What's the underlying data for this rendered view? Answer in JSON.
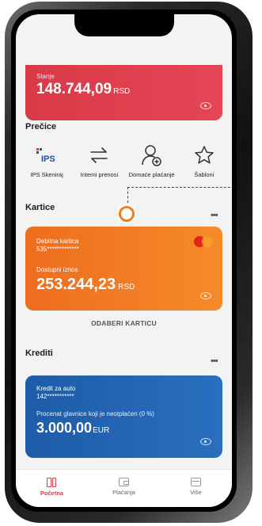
{
  "balance": {
    "label": "Stanje",
    "amount": "148.744,09",
    "currency": "RSD"
  },
  "shortcuts": {
    "title": "Prečice",
    "items": [
      {
        "label": "IPS Skeniraj",
        "icon": "ips-logo-icon"
      },
      {
        "label": "Interni prenosi",
        "icon": "swap-arrows-icon"
      },
      {
        "label": "Domaće plaćanje",
        "icon": "user-add-icon"
      },
      {
        "label": "Šabloni",
        "icon": "star-icon"
      }
    ]
  },
  "cards": {
    "title": "Kartice",
    "more": "•••",
    "card": {
      "type": "Debitna kartica",
      "number": "535*************",
      "available_label": "Dostupni iznos",
      "amount": "253.244,23",
      "currency": "RSD"
    },
    "choose_label": "ODABERI KARTICU"
  },
  "credits": {
    "title": "Krediti",
    "more": "•••",
    "item": {
      "name": "Kredit za auto",
      "number": "142***********",
      "desc": "Procenat glavnice koji je neotplaćen (0 %)",
      "amount": "3.000,00",
      "currency": "EUR"
    }
  },
  "nav": {
    "items": [
      {
        "label": "Početna",
        "icon": "home-icon",
        "active": true
      },
      {
        "label": "Plaćanja",
        "icon": "wallet-icon",
        "active": false
      },
      {
        "label": "Više",
        "icon": "more-icon",
        "active": false
      }
    ]
  },
  "colors": {
    "red": "#d83a48",
    "orange": "#ee6d1e",
    "blue": "#1d5ca8",
    "accent": "#d73a47"
  }
}
